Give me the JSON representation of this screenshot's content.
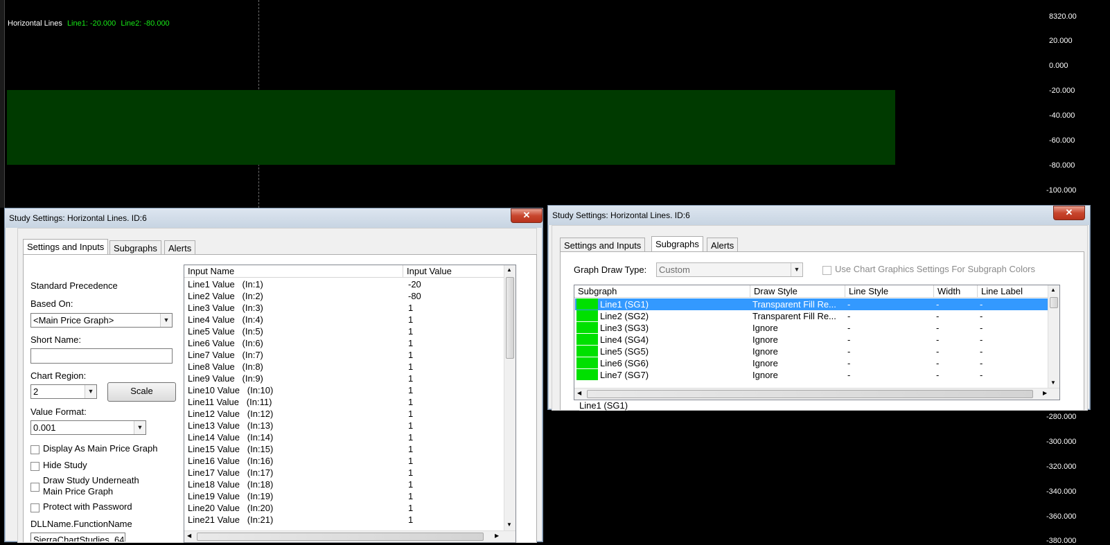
{
  "chart": {
    "study_label": "Horizontal Lines",
    "line1_label": "Line1: -20.000",
    "line2_label": "Line2: -80.000",
    "band_color": "#003a00",
    "label_color": "#17e817",
    "y_labels_top": [
      "8320.00",
      "20.000",
      "0.000",
      "-20.000",
      "-40.000",
      "-60.000",
      "-80.000",
      "-100.000"
    ],
    "y_labels_bottom": [
      "-280.000",
      "-300.000",
      "-320.000",
      "-340.000",
      "-360.000",
      "-380.000"
    ]
  },
  "dialog_left": {
    "title": "Study Settings: Horizontal Lines. ID:6",
    "close": "✕",
    "tabs": [
      "Settings and Inputs",
      "Subgraphs",
      "Alerts"
    ],
    "standard_precedence": "Standard Precedence",
    "based_on_label": "Based On:",
    "based_on_value": "<Main Price Graph>",
    "short_name_label": "Short Name:",
    "short_name_value": "",
    "chart_region_label": "Chart Region:",
    "chart_region_value": "2",
    "scale_button": "Scale",
    "value_format_label": "Value Format:",
    "value_format_value": "0.001",
    "checkboxes": [
      "Display As Main Price Graph",
      "Hide Study",
      "Draw Study Underneath",
      "Main Price Graph",
      "Protect with Password"
    ],
    "dll_label": "DLLName.FunctionName",
    "dll_value": "SierraChartStudies_64",
    "inputs_header": [
      "Input Name",
      "Input Value"
    ],
    "inputs": [
      [
        "Line1 Value   (In:1)",
        "-20"
      ],
      [
        "Line2 Value   (In:2)",
        "-80"
      ],
      [
        "Line3 Value   (In:3)",
        "1"
      ],
      [
        "Line4 Value   (In:4)",
        "1"
      ],
      [
        "Line5 Value   (In:5)",
        "1"
      ],
      [
        "Line6 Value   (In:6)",
        "1"
      ],
      [
        "Line7 Value   (In:7)",
        "1"
      ],
      [
        "Line8 Value   (In:8)",
        "1"
      ],
      [
        "Line9 Value   (In:9)",
        "1"
      ],
      [
        "Line10 Value   (In:10)",
        "1"
      ],
      [
        "Line11 Value   (In:11)",
        "1"
      ],
      [
        "Line12 Value   (In:12)",
        "1"
      ],
      [
        "Line13 Value   (In:13)",
        "1"
      ],
      [
        "Line14 Value   (In:14)",
        "1"
      ],
      [
        "Line15 Value   (In:15)",
        "1"
      ],
      [
        "Line16 Value   (In:16)",
        "1"
      ],
      [
        "Line17 Value   (In:17)",
        "1"
      ],
      [
        "Line18 Value   (In:18)",
        "1"
      ],
      [
        "Line19 Value   (In:19)",
        "1"
      ],
      [
        "Line20 Value   (In:20)",
        "1"
      ],
      [
        "Line21 Value   (In:21)",
        "1"
      ]
    ]
  },
  "dialog_right": {
    "title": "Study Settings: Horizontal Lines. ID:6",
    "close": "✕",
    "tabs": [
      "Settings and Inputs",
      "Subgraphs",
      "Alerts"
    ],
    "graph_draw_type_label": "Graph Draw Type:",
    "graph_draw_type_value": "Custom",
    "use_chart_graphics": "Use Chart Graphics Settings For Subgraph Colors",
    "subgraph_header": [
      "Subgraph",
      "Draw Style",
      "Line Style",
      "Width",
      "Line Label"
    ],
    "subgraphs": [
      [
        "Line1 (SG1)",
        "Transparent Fill Re...",
        "-",
        "-",
        "-"
      ],
      [
        "Line2 (SG2)",
        "Transparent Fill Re...",
        "-",
        "-",
        "-"
      ],
      [
        "Line3 (SG3)",
        "Ignore",
        "-",
        "-",
        "-"
      ],
      [
        "Line4 (SG4)",
        "Ignore",
        "-",
        "-",
        "-"
      ],
      [
        "Line5 (SG5)",
        "Ignore",
        "-",
        "-",
        "-"
      ],
      [
        "Line6 (SG6)",
        "Ignore",
        "-",
        "-",
        "-"
      ],
      [
        "Line7 (SG7)",
        "Ignore",
        "-",
        "-",
        "-"
      ]
    ],
    "group_label": "Line1 (SG1)",
    "selected_color": "#3399ff",
    "swatch_color": "#00e000"
  }
}
